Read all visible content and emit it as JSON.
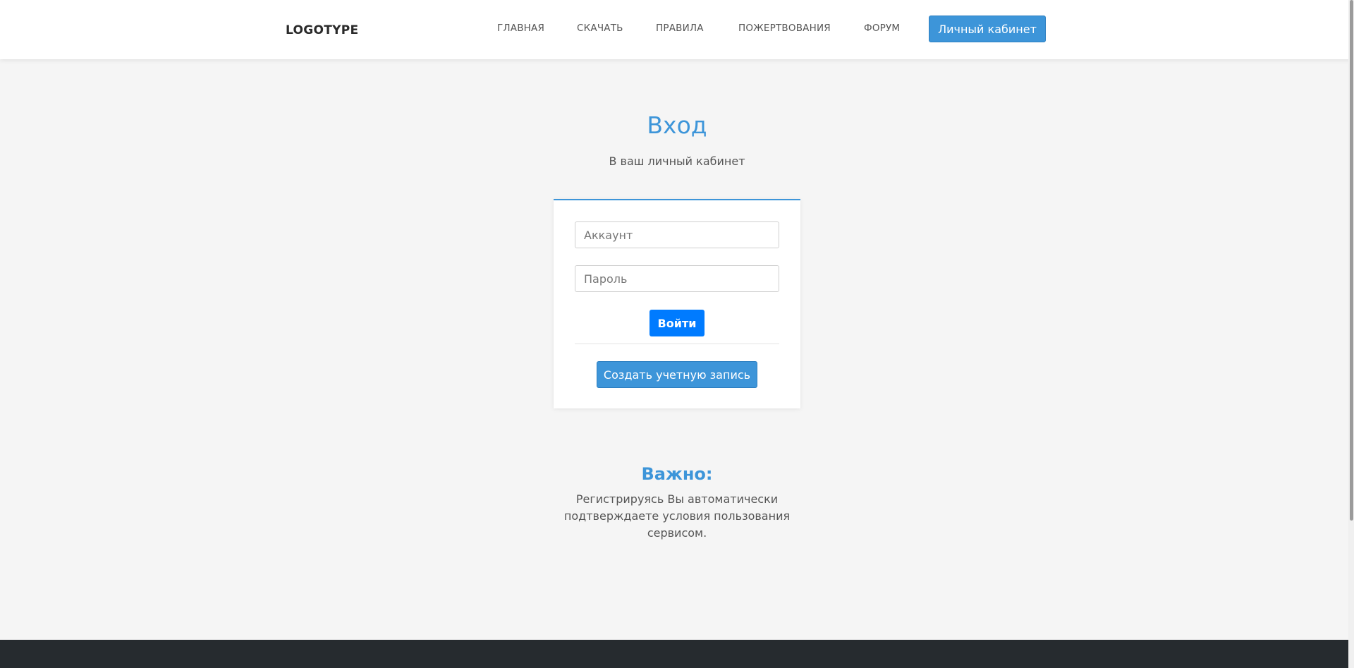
{
  "header": {
    "logo": "LOGOTYPE",
    "nav": [
      {
        "label": "ГЛАВНАЯ"
      },
      {
        "label": "СКАЧАТЬ"
      },
      {
        "label": "ПРАВИЛА"
      },
      {
        "label": "ПОЖЕРТВОВАНИЯ"
      },
      {
        "label": "ФОРУМ"
      }
    ],
    "cabinet_button": "Личный кабинет"
  },
  "login": {
    "title": "Вход",
    "subtitle": "В ваш личный кабинет",
    "account_placeholder": "Аккаунт",
    "account_value": "",
    "password_placeholder": "Пароль",
    "password_value": "",
    "submit_label": "Войти",
    "register_label": "Создать учетную запись"
  },
  "important": {
    "title": "Важно:",
    "text": "Регистрируясь Вы автоматически подтверждаете условия пользования сервисом."
  },
  "colors": {
    "accent": "#3d95d9",
    "primary_button": "#007bff",
    "footer": "#262b2f",
    "background": "#f5f5f5"
  }
}
